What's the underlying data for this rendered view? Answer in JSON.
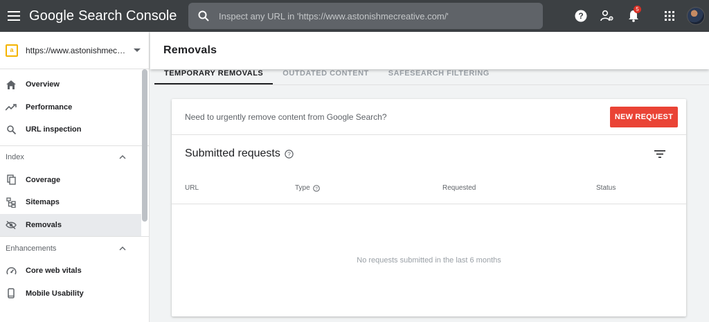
{
  "header": {
    "brand_google": "Google",
    "brand_product": "Search Console",
    "search_placeholder": "Inspect any URL in 'https://www.astonishmecreative.com/'",
    "notification_count": "5"
  },
  "sidebar": {
    "property_url": "https://www.astonishmecreative.com/",
    "top_items": [
      {
        "label": "Overview",
        "icon": "home-icon"
      },
      {
        "label": "Performance",
        "icon": "trending-up-icon"
      },
      {
        "label": "URL inspection",
        "icon": "search-icon"
      }
    ],
    "index_section": {
      "label": "Index",
      "items": [
        {
          "label": "Coverage",
          "icon": "coverage-icon"
        },
        {
          "label": "Sitemaps",
          "icon": "sitemap-icon"
        },
        {
          "label": "Removals",
          "icon": "eye-off-icon",
          "active": true
        }
      ]
    },
    "enhancements_section": {
      "label": "Enhancements",
      "items": [
        {
          "label": "Core web vitals",
          "icon": "speedometer-icon"
        },
        {
          "label": "Mobile Usability",
          "icon": "phone-icon"
        }
      ]
    }
  },
  "main": {
    "page_title": "Removals",
    "tabs": [
      {
        "label": "Temporary removals",
        "active": true
      },
      {
        "label": "Outdated content"
      },
      {
        "label": "SafeSearch filtering"
      }
    ],
    "card": {
      "question": "Need to urgently remove content from Google Search?",
      "new_request_label": "NEW REQUEST",
      "submitted_title": "Submitted requests",
      "columns": [
        "URL",
        "Type",
        "Requested",
        "Status"
      ],
      "empty_message": "No requests submitted in the last 6 months"
    }
  },
  "colors": {
    "topbar": "#3c4043",
    "accent_red": "#ea4335",
    "property_icon": "#f4b400"
  }
}
